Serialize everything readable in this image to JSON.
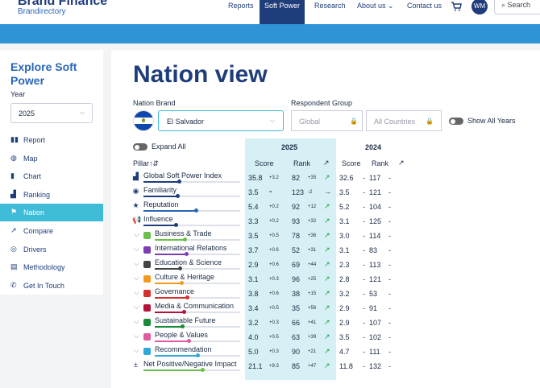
{
  "header": {
    "brand": "Brand Finance",
    "sub": "Brandirectory",
    "nav": [
      "Reports",
      "Soft Power",
      "Research",
      "About us",
      "Contact us"
    ],
    "about_chev": "⌄",
    "active": "Soft Power",
    "avatar": "WM",
    "search_placeholder": "Search"
  },
  "sidebar": {
    "title": "Explore Soft Power",
    "year_label": "Year",
    "year_value": "2025",
    "items": [
      {
        "label": "Report",
        "icon": "book-icon"
      },
      {
        "label": "Map",
        "icon": "globe-icon"
      },
      {
        "label": "Chart",
        "icon": "bar-chart-icon"
      },
      {
        "label": "Ranking",
        "icon": "ranking-icon"
      },
      {
        "label": "Nation",
        "icon": "flag-icon",
        "active": true
      },
      {
        "label": "Compare",
        "icon": "compare-icon"
      },
      {
        "label": "Drivers",
        "icon": "drivers-icon"
      },
      {
        "label": "Methodology",
        "icon": "methodology-icon"
      },
      {
        "label": "Get In Touch",
        "icon": "phone-icon"
      }
    ]
  },
  "main": {
    "title": "Nation view",
    "nation_label": "Nation Brand",
    "nation_value": "El Salvador",
    "respondent_label": "Respondent Group",
    "respondent_value": "Global",
    "respondent_countries": "All Countries",
    "show_all_years": "Show All Years",
    "expand_all": "Expand All",
    "pillar_header": "Pillar",
    "pillar_sort_icon": "↑⇵",
    "year_current": "2025",
    "year_prev": "2024",
    "score_header": "Score",
    "rank_header": "Rank",
    "trend_icon_header": "↗",
    "accent_colors": {
      "highlight": "#d7f0f5",
      "nav": "#1f3d7a",
      "band": "#2f94d6",
      "active": "#3fbcd8",
      "up": "#1a9b4a"
    }
  },
  "rows": [
    {
      "name": "Global Soft Power Index",
      "score": "35.8",
      "sdelta": "+3.2",
      "rank": "82",
      "rdelta": "+35",
      "trend": "↗",
      "pscore": "32.6",
      "prank": "117",
      "level": 0.37,
      "color": "#1f3d7a",
      "icon": "index-icon",
      "glyph": "▟",
      "expandable": false
    },
    {
      "name": "Familiarity",
      "score": "3.5",
      "sdelta": "=",
      "rank": "123",
      "rdelta": "-2",
      "trend": "→",
      "pscore": "3.5",
      "prank": "121",
      "level": 0.35,
      "color": "#1f3d7a",
      "icon": "eye-icon",
      "glyph": "◉",
      "expandable": false
    },
    {
      "name": "Reputation",
      "score": "5.4",
      "sdelta": "+0.2",
      "rank": "92",
      "rdelta": "+12",
      "trend": "↗",
      "pscore": "5.2",
      "prank": "104",
      "level": 0.54,
      "color": "#2a66b8",
      "icon": "star-icon",
      "glyph": "★",
      "expandable": false
    },
    {
      "name": "Influence",
      "score": "3.3",
      "sdelta": "+0.2",
      "rank": "93",
      "rdelta": "+32",
      "trend": "↗",
      "pscore": "3.1",
      "prank": "125",
      "level": 0.33,
      "color": "#1f3d7a",
      "icon": "megaphone-icon",
      "glyph": "📢",
      "expandable": false
    },
    {
      "name": "Business & Trade",
      "score": "3.5",
      "sdelta": "+0.5",
      "rank": "78",
      "rdelta": "+36",
      "trend": "↗",
      "pscore": "3.0",
      "prank": "114",
      "level": 0.35,
      "color": "#6cc04a",
      "icon": "money-icon",
      "glyph": "▤",
      "expandable": true
    },
    {
      "name": "International Relations",
      "score": "3.7",
      "sdelta": "+0.6",
      "rank": "52",
      "rdelta": "+31",
      "trend": "↗",
      "pscore": "3.1",
      "prank": "83",
      "level": 0.37,
      "color": "#7b3fb3",
      "icon": "globe-icon",
      "glyph": "⊕",
      "expandable": true
    },
    {
      "name": "Education & Science",
      "score": "2.9",
      "sdelta": "+0.6",
      "rank": "69",
      "rdelta": "+44",
      "trend": "↗",
      "pscore": "2.3",
      "prank": "113",
      "level": 0.29,
      "color": "#444444",
      "icon": "microscope-icon",
      "glyph": "⚗",
      "expandable": true
    },
    {
      "name": "Culture & Heritage",
      "score": "3.1",
      "sdelta": "+0.3",
      "rank": "96",
      "rdelta": "+25",
      "trend": "↗",
      "pscore": "2.8",
      "prank": "121",
      "level": 0.31,
      "color": "#f29a1f",
      "icon": "museum-icon",
      "glyph": "▥",
      "expandable": true
    },
    {
      "name": "Governance",
      "score": "3.8",
      "sdelta": "+0.6",
      "rank": "38",
      "rdelta": "+15",
      "trend": "↗",
      "pscore": "3.2",
      "prank": "53",
      "level": 0.38,
      "color": "#d62f2f",
      "icon": "scales-icon",
      "glyph": "⚖",
      "expandable": true
    },
    {
      "name": "Media & Communication",
      "score": "3.4",
      "sdelta": "+0.5",
      "rank": "35",
      "rdelta": "+56",
      "trend": "↗",
      "pscore": "2.9",
      "prank": "91",
      "level": 0.34,
      "color": "#b3123a",
      "icon": "tv-icon",
      "glyph": "▣",
      "expandable": true
    },
    {
      "name": "Sustainable Future",
      "score": "3.2",
      "sdelta": "+0.3",
      "rank": "66",
      "rdelta": "+41",
      "trend": "↗",
      "pscore": "2.9",
      "prank": "107",
      "level": 0.32,
      "color": "#1a8a3a",
      "icon": "leaf-icon",
      "glyph": "❦",
      "expandable": true
    },
    {
      "name": "People & Values",
      "score": "4.0",
      "sdelta": "+0.5",
      "rank": "63",
      "rdelta": "+39",
      "trend": "↗",
      "pscore": "3.5",
      "prank": "102",
      "level": 0.4,
      "color": "#e05aa0",
      "icon": "people-icon",
      "glyph": "✿",
      "expandable": true
    },
    {
      "name": "Recommendation",
      "score": "5.0",
      "sdelta": "+0.3",
      "rank": "90",
      "rdelta": "+21",
      "trend": "↗",
      "pscore": "4.7",
      "prank": "111",
      "level": 0.5,
      "color": "#2fa8d8",
      "icon": "recommend-icon",
      "glyph": "≡",
      "expandable": true
    },
    {
      "name": "Net Positive/Negative Impact",
      "score": "21.1",
      "sdelta": "+9.3",
      "rank": "85",
      "rdelta": "+47",
      "trend": "↗",
      "pscore": "11.8",
      "prank": "132",
      "level": 0.61,
      "color": "#6cc04a",
      "icon": "plus-minus-icon",
      "glyph": "±",
      "expandable": false
    }
  ]
}
